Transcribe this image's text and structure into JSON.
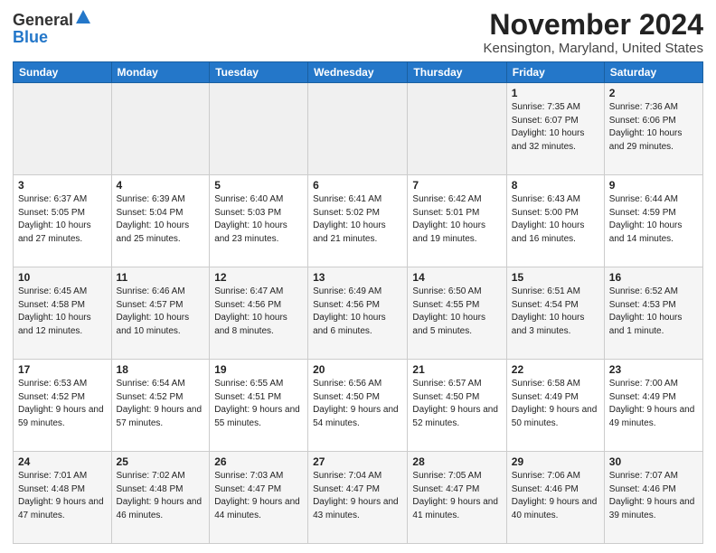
{
  "logo": {
    "general": "General",
    "blue": "Blue"
  },
  "title": "November 2024",
  "location": "Kensington, Maryland, United States",
  "days_of_week": [
    "Sunday",
    "Monday",
    "Tuesday",
    "Wednesday",
    "Thursday",
    "Friday",
    "Saturday"
  ],
  "weeks": [
    [
      {
        "day": "",
        "info": ""
      },
      {
        "day": "",
        "info": ""
      },
      {
        "day": "",
        "info": ""
      },
      {
        "day": "",
        "info": ""
      },
      {
        "day": "",
        "info": ""
      },
      {
        "day": "1",
        "info": "Sunrise: 7:35 AM\nSunset: 6:07 PM\nDaylight: 10 hours and 32 minutes."
      },
      {
        "day": "2",
        "info": "Sunrise: 7:36 AM\nSunset: 6:06 PM\nDaylight: 10 hours and 29 minutes."
      }
    ],
    [
      {
        "day": "3",
        "info": "Sunrise: 6:37 AM\nSunset: 5:05 PM\nDaylight: 10 hours and 27 minutes."
      },
      {
        "day": "4",
        "info": "Sunrise: 6:39 AM\nSunset: 5:04 PM\nDaylight: 10 hours and 25 minutes."
      },
      {
        "day": "5",
        "info": "Sunrise: 6:40 AM\nSunset: 5:03 PM\nDaylight: 10 hours and 23 minutes."
      },
      {
        "day": "6",
        "info": "Sunrise: 6:41 AM\nSunset: 5:02 PM\nDaylight: 10 hours and 21 minutes."
      },
      {
        "day": "7",
        "info": "Sunrise: 6:42 AM\nSunset: 5:01 PM\nDaylight: 10 hours and 19 minutes."
      },
      {
        "day": "8",
        "info": "Sunrise: 6:43 AM\nSunset: 5:00 PM\nDaylight: 10 hours and 16 minutes."
      },
      {
        "day": "9",
        "info": "Sunrise: 6:44 AM\nSunset: 4:59 PM\nDaylight: 10 hours and 14 minutes."
      }
    ],
    [
      {
        "day": "10",
        "info": "Sunrise: 6:45 AM\nSunset: 4:58 PM\nDaylight: 10 hours and 12 minutes."
      },
      {
        "day": "11",
        "info": "Sunrise: 6:46 AM\nSunset: 4:57 PM\nDaylight: 10 hours and 10 minutes."
      },
      {
        "day": "12",
        "info": "Sunrise: 6:47 AM\nSunset: 4:56 PM\nDaylight: 10 hours and 8 minutes."
      },
      {
        "day": "13",
        "info": "Sunrise: 6:49 AM\nSunset: 4:56 PM\nDaylight: 10 hours and 6 minutes."
      },
      {
        "day": "14",
        "info": "Sunrise: 6:50 AM\nSunset: 4:55 PM\nDaylight: 10 hours and 5 minutes."
      },
      {
        "day": "15",
        "info": "Sunrise: 6:51 AM\nSunset: 4:54 PM\nDaylight: 10 hours and 3 minutes."
      },
      {
        "day": "16",
        "info": "Sunrise: 6:52 AM\nSunset: 4:53 PM\nDaylight: 10 hours and 1 minute."
      }
    ],
    [
      {
        "day": "17",
        "info": "Sunrise: 6:53 AM\nSunset: 4:52 PM\nDaylight: 9 hours and 59 minutes."
      },
      {
        "day": "18",
        "info": "Sunrise: 6:54 AM\nSunset: 4:52 PM\nDaylight: 9 hours and 57 minutes."
      },
      {
        "day": "19",
        "info": "Sunrise: 6:55 AM\nSunset: 4:51 PM\nDaylight: 9 hours and 55 minutes."
      },
      {
        "day": "20",
        "info": "Sunrise: 6:56 AM\nSunset: 4:50 PM\nDaylight: 9 hours and 54 minutes."
      },
      {
        "day": "21",
        "info": "Sunrise: 6:57 AM\nSunset: 4:50 PM\nDaylight: 9 hours and 52 minutes."
      },
      {
        "day": "22",
        "info": "Sunrise: 6:58 AM\nSunset: 4:49 PM\nDaylight: 9 hours and 50 minutes."
      },
      {
        "day": "23",
        "info": "Sunrise: 7:00 AM\nSunset: 4:49 PM\nDaylight: 9 hours and 49 minutes."
      }
    ],
    [
      {
        "day": "24",
        "info": "Sunrise: 7:01 AM\nSunset: 4:48 PM\nDaylight: 9 hours and 47 minutes."
      },
      {
        "day": "25",
        "info": "Sunrise: 7:02 AM\nSunset: 4:48 PM\nDaylight: 9 hours and 46 minutes."
      },
      {
        "day": "26",
        "info": "Sunrise: 7:03 AM\nSunset: 4:47 PM\nDaylight: 9 hours and 44 minutes."
      },
      {
        "day": "27",
        "info": "Sunrise: 7:04 AM\nSunset: 4:47 PM\nDaylight: 9 hours and 43 minutes."
      },
      {
        "day": "28",
        "info": "Sunrise: 7:05 AM\nSunset: 4:47 PM\nDaylight: 9 hours and 41 minutes."
      },
      {
        "day": "29",
        "info": "Sunrise: 7:06 AM\nSunset: 4:46 PM\nDaylight: 9 hours and 40 minutes."
      },
      {
        "day": "30",
        "info": "Sunrise: 7:07 AM\nSunset: 4:46 PM\nDaylight: 9 hours and 39 minutes."
      }
    ]
  ]
}
